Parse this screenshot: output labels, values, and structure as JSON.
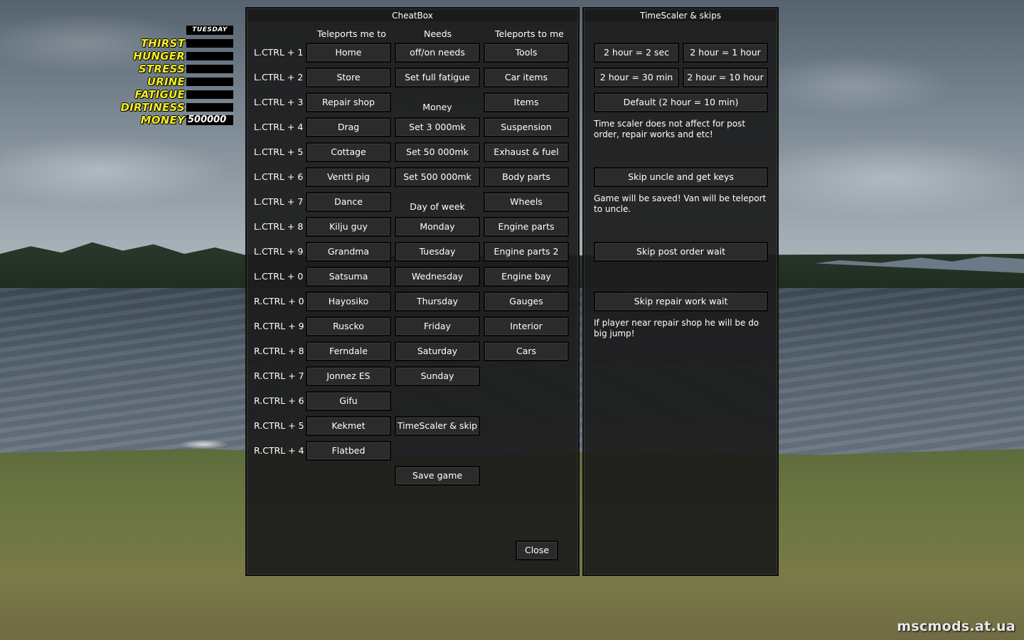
{
  "hud": {
    "day": "TUESDAY",
    "stats": [
      "THIRST",
      "HUNGER",
      "STRESS",
      "URINE",
      "FATIGUE",
      "DIRTINESS"
    ],
    "money_label": "MONEY",
    "money_value": "500000"
  },
  "cheatbox": {
    "title": "CheatBox",
    "headers": {
      "teleport_me_to": "Teleports me to",
      "needs": "Needs",
      "teleport_to_me": "Teleports to me"
    },
    "hotkeys": [
      "L.CTRL + 1",
      "L.CTRL + 2",
      "L.CTRL + 3",
      "L.CTRL + 4",
      "L.CTRL + 5",
      "L.CTRL + 6",
      "L.CTRL + 7",
      "L.CTRL + 8",
      "L.CTRL + 9",
      "L.CTRL + 0",
      "R.CTRL + 0",
      "R.CTRL + 9",
      "R.CTRL + 8",
      "R.CTRL + 7",
      "R.CTRL + 6",
      "R.CTRL + 5",
      "R.CTRL + 4"
    ],
    "teleport_me_to": [
      "Home",
      "Store",
      "Repair shop",
      "Drag",
      "Cottage",
      "Ventti pig",
      "Dance",
      "Kilju guy",
      "Grandma",
      "Satsuma",
      "Hayosiko",
      "Ruscko",
      "Ferndale",
      "Jonnez ES",
      "Gifu",
      "Kekmet",
      "Flatbed"
    ],
    "needs_column": {
      "toggle_needs": "off/on needs",
      "full_fatigue": "Set full fatigue",
      "money_label": "Money",
      "money_buttons": [
        "Set 3 000mk",
        "Set 50 000mk",
        "Set 500 000mk"
      ],
      "day_label": "Day of week",
      "days": [
        "Monday",
        "Tuesday",
        "Wednesday",
        "Thursday",
        "Friday",
        "Saturday",
        "Sunday"
      ],
      "timescaler": "TimeScaler & skip",
      "save": "Save game"
    },
    "teleport_to_me": [
      "Tools",
      "Car items",
      "Items",
      "Suspension",
      "Exhaust & fuel",
      "Body parts",
      "Wheels",
      "Engine parts",
      "Engine parts 2",
      "Engine bay",
      "Gauges",
      "Interior",
      "Cars"
    ],
    "close": "Close"
  },
  "timescaler": {
    "title": "TimeScaler & skips",
    "scale_buttons": [
      "2 hour = 2 sec",
      "2 hour = 1 hour",
      "2 hour = 30 min",
      "2 hour = 10 hour"
    ],
    "default": "Default (2 hour = 10 min)",
    "scale_note": "Time scaler does not affect for post order, repair works and etc!",
    "skip_uncle": "Skip uncle and get keys",
    "uncle_note": "Game will be saved! Van will be teleport to uncle.",
    "skip_post": "Skip post order wait",
    "skip_repair": "Skip repair work wait",
    "repair_note": "If player near repair shop he will be do big jump!"
  },
  "watermark": "mscmods.at.ua"
}
